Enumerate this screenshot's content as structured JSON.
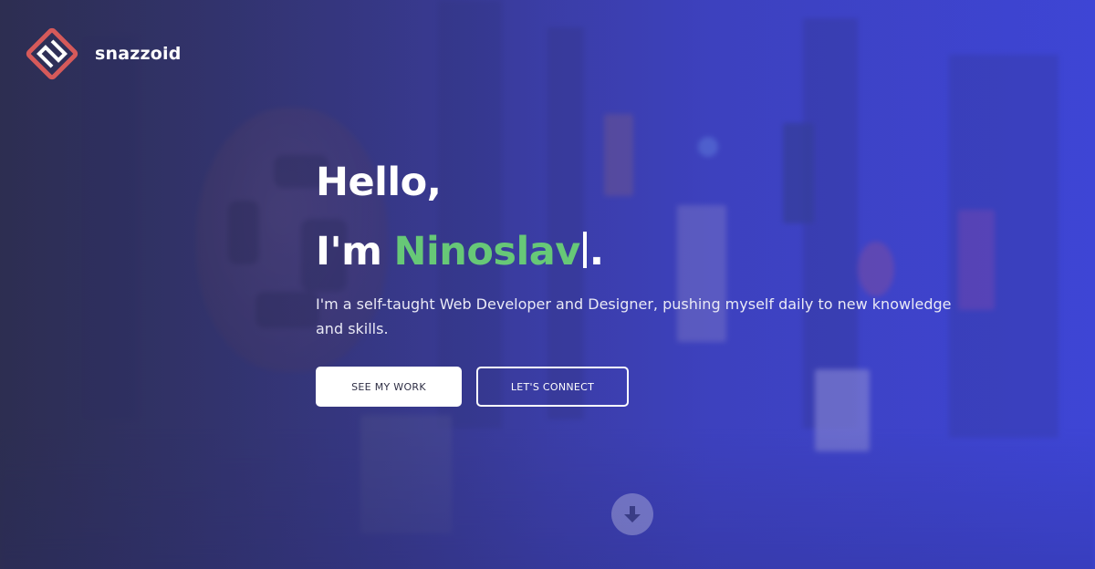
{
  "brand": {
    "name": "snazzoid",
    "logo_icon": "snazzoid-logo-icon",
    "logo_color": "#d65a5a"
  },
  "hero": {
    "greeting": "Hello,",
    "intro_prefix": "I'm",
    "name": "Ninoslav",
    "intro_suffix": ".",
    "name_color": "#67c877",
    "tagline": "I'm a self-taught Web Developer and Designer, pushing myself daily to new knowledge and skills.",
    "primary_button": "SEE MY WORK",
    "secondary_button": "LET'S CONNECT",
    "scroll_icon": "arrow-down-circle-icon"
  },
  "colors": {
    "background_left": "#33355f",
    "background_right": "#3e46d6",
    "text": "#ffffff",
    "primary_button_bg": "#ffffff",
    "primary_button_text": "#2f2f45"
  }
}
